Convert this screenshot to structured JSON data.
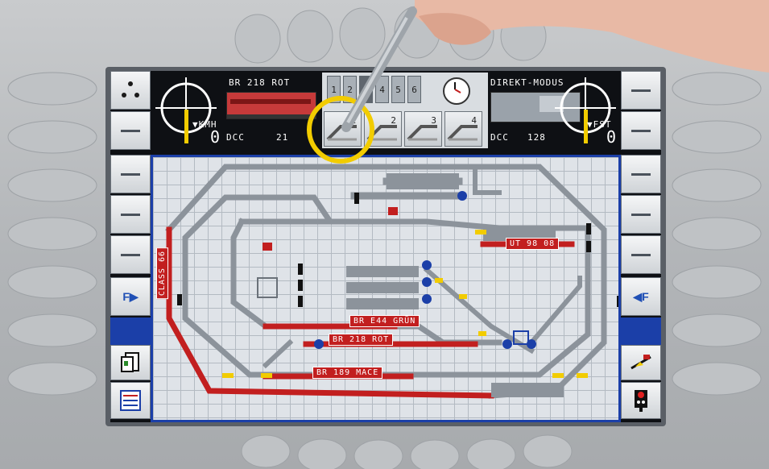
{
  "left_cab": {
    "loco_name": "BR 218 ROT",
    "speed_unit": "▼KMH",
    "speed_value": "0",
    "protocol": "DCC",
    "address": "21"
  },
  "right_cab": {
    "mode": "DIREKT-MODUS",
    "speed_unit": "▼FST",
    "speed_value": "0",
    "protocol": "DCC",
    "address": "128"
  },
  "route_tabs": [
    "1",
    "2",
    "3",
    "4",
    "5",
    "6"
  ],
  "switch_buttons": [
    "1",
    "2",
    "3",
    "4"
  ],
  "left_buttons": {
    "function_label": "F▶"
  },
  "right_buttons": {
    "function_label": "◀F"
  },
  "track_labels": {
    "vertical": "CLASS 66",
    "ut98": "UT 98 08",
    "e44": "BR E44 GRÜN",
    "br218": "BR 218 ROT",
    "br189": "BR 189 MACE"
  },
  "colors": {
    "accent_blue": "#1b3fa8",
    "track_red": "#c21f1f",
    "track_grey": "#8c939b",
    "highlight_ring": "#f2cc00"
  }
}
